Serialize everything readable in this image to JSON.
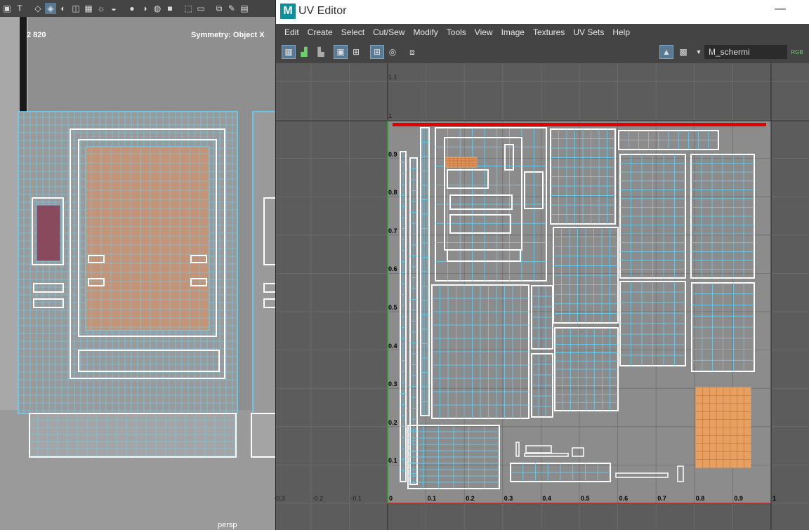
{
  "viewport": {
    "poly_count": "2 820",
    "symmetry": "Symmetry: Object X",
    "camera": "persp",
    "toolbar_icons": [
      "smooth-shade-icon",
      "textured-icon",
      "cube-icon",
      "wireframe-on-shaded-icon",
      "isolate-icon",
      "xray-icon",
      "light-icon",
      "shadow-icon",
      "ao-icon",
      "resolution-icon",
      "camera-icon",
      "gate-icon",
      "film-icon",
      "grid-icon",
      "hud-icon"
    ]
  },
  "uv_editor": {
    "title": "UV Editor",
    "logo": "M",
    "minimize": "—",
    "menu": [
      "Edit",
      "Create",
      "Select",
      "Cut/Sew",
      "Modify",
      "Tools",
      "View",
      "Image",
      "Textures",
      "UV Sets",
      "Help"
    ],
    "texture_name": "M_schermi",
    "rgb_label": "RGB",
    "x_axis_labels": [
      "-0.3",
      "-0.2",
      "-0.1",
      "0",
      "0.1",
      "0.2",
      "0.3",
      "0.4",
      "0.5",
      "0.6",
      "0.7",
      "0.8",
      "0.9",
      "1"
    ],
    "y_axis_labels": [
      "1.1",
      "1",
      "0.9",
      "0.8",
      "0.7",
      "0.6",
      "0.5",
      "0.4",
      "0.3",
      "0.2",
      "0.1"
    ],
    "colors": {
      "uv_shell": "#ffffff",
      "uv_wire": "#5fd8ff",
      "highlight_shell": "#e8a060",
      "top_edge": "#e00000",
      "x_axis": "#cc2222",
      "y_axis": "#22aa22",
      "grid_bg": "#8c8c8c",
      "outside_bg": "#5c5c5c"
    }
  }
}
